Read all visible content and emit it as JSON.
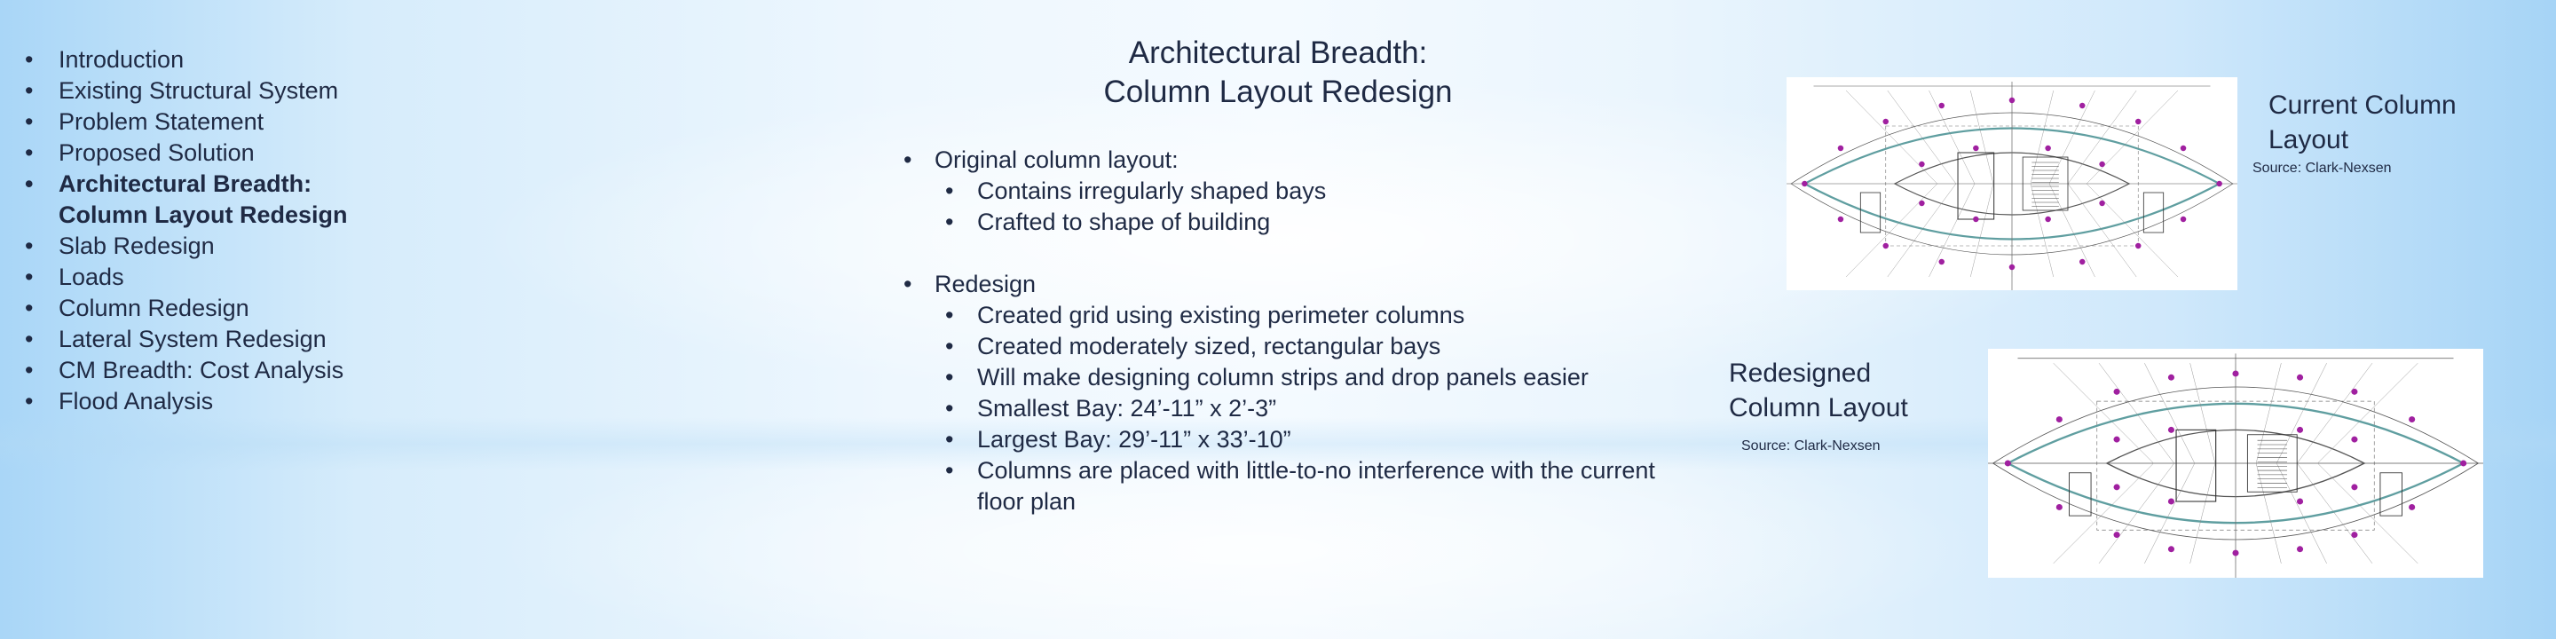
{
  "nav": {
    "items": [
      {
        "label": "Introduction",
        "active": false
      },
      {
        "label": "Existing Structural System",
        "active": false
      },
      {
        "label": "Problem Statement",
        "active": false
      },
      {
        "label": "Proposed Solution",
        "active": false
      },
      {
        "label": "Architectural Breadth:",
        "label2": "Column Layout Redesign",
        "active": true
      },
      {
        "label": "Slab Redesign",
        "active": false
      },
      {
        "label": "Loads",
        "active": false
      },
      {
        "label": "Column Redesign",
        "active": false
      },
      {
        "label": "Lateral System Redesign",
        "active": false
      },
      {
        "label": "CM Breadth: Cost Analysis",
        "active": false
      },
      {
        "label": "Flood Analysis",
        "active": false
      }
    ]
  },
  "slide": {
    "title_line1": "Architectural Breadth:",
    "title_line2": "Column Layout Redesign",
    "sections": [
      {
        "heading": "Original column layout:",
        "bullets": [
          "Contains irregularly shaped bays",
          "Crafted to shape of building"
        ]
      },
      {
        "heading": "Redesign",
        "bullets": [
          "Created grid using existing perimeter columns",
          "Created moderately sized, rectangular bays",
          "Will make designing column strips and drop panels easier",
          "Smallest Bay: 24’-11” x 2’-3”",
          "Largest Bay: 29’-11” x 33’-10”",
          "Columns are placed with little-to-no interference with the current floor plan"
        ]
      }
    ]
  },
  "figures": {
    "current": {
      "caption_line1": "Current Column",
      "caption_line2": "Layout",
      "source": "Source: Clark-Nexsen"
    },
    "redesigned": {
      "caption_line1": "Redesigned",
      "caption_line2": "Column Layout",
      "source": "Source: Clark-Nexsen"
    }
  },
  "colors": {
    "text": "#1f2a44",
    "column_marker": "#a020a0",
    "slab_edge": "#5f9ea0"
  }
}
